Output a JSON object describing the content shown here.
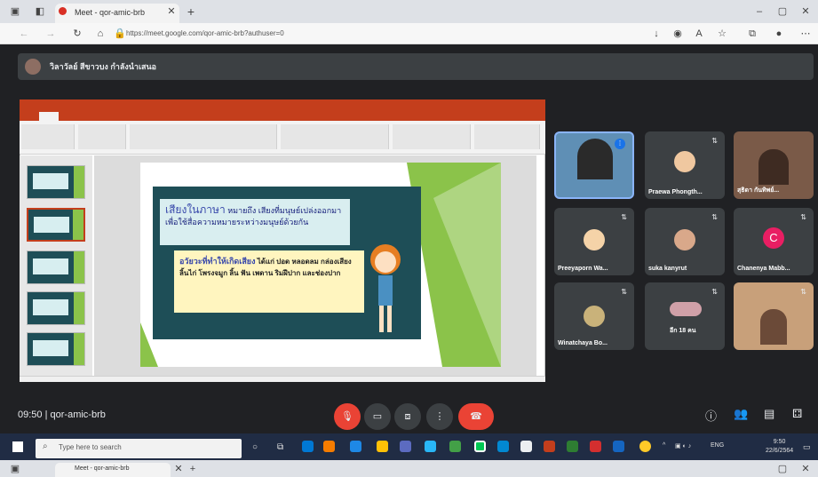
{
  "browser": {
    "tab_title": "Meet - qor-amic-brb",
    "new_tab": "+",
    "url": "https://meet.google.com/qor-amic-brb?authuser=0",
    "window_controls": [
      "–",
      "▢",
      "✕"
    ]
  },
  "meet": {
    "presenter_label": "วิลาวัลย์ สีขาวบง กำลังนำเสนอ",
    "meeting_time": "09:50",
    "meeting_code": "qor-amic-brb",
    "participants": [
      {
        "name": "",
        "avatar_letter": ""
      },
      {
        "name": "Praewa Phongth...",
        "avatar_letter": ""
      },
      {
        "name": "สุธิดา กันทิพย์...",
        "avatar_letter": ""
      },
      {
        "name": "Preeyaporn Wa...",
        "avatar_letter": ""
      },
      {
        "name": "suka kanyrut",
        "avatar_letter": ""
      },
      {
        "name": "Chanenya Mabb...",
        "avatar_letter": "C"
      },
      {
        "name": "Winatchaya Bo...",
        "avatar_letter": ""
      },
      {
        "name": "อีก 18 คน",
        "avatar_letter": ""
      },
      {
        "name": "",
        "avatar_letter": ""
      }
    ]
  },
  "slide": {
    "box1_title": "เสียงในภาษา",
    "box1_text": "หมายถึง เสียงที่มนุษย์เปล่งออกมา เพื่อใช้สื่อความหมายระหว่างมนุษย์ด้วยกัน",
    "box2_title": "อวัยวะที่ทำให้เกิดเสียง",
    "box2_text": "ได้แก่ ปอด หลอดลม กล่องเสียง ลิ้นไก่ โพรงจมูก ลิ้น ฟัน เพดาน ริมฝีปาก และช่องปาก"
  },
  "taskbar": {
    "search_placeholder": "Type here to search",
    "clock_time": "9:50",
    "clock_date": "22/6/2564",
    "lang": "ENG"
  },
  "colors": {
    "meet_bg": "#202124",
    "tile_bg": "#3c4043",
    "end_call": "#ea4335",
    "ppt_brand": "#c43e1c",
    "slide_teal": "#1e4e57",
    "slide_green": "#8bc34a"
  }
}
